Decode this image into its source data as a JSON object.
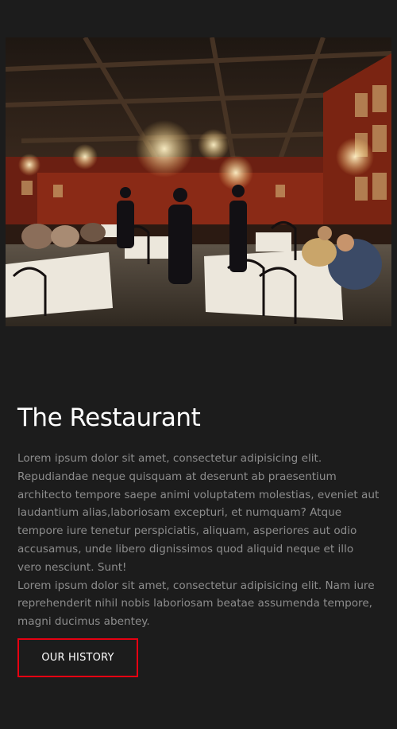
{
  "section": {
    "image_alt": "Restaurant dining room",
    "title": "The Restaurant",
    "paragraph_1": "Lorem ipsum dolor sit amet, consectetur adipisicing elit. Repudiandae neque quisquam at deserunt ab praesentium architecto tempore saepe animi voluptatem molestias, eveniet aut laudantium alias,laboriosam excepturi, et numquam? Atque tempore iure tenetur perspiciatis, aliquam, asperiores aut odio accusamus, unde libero dignissimos quod aliquid neque et illo vero nesciunt. Sunt!",
    "paragraph_2": "Lorem ipsum dolor sit amet, consectetur adipisicing elit. Nam iure reprehenderit nihil nobis laboriosam beatae assumenda tempore, magni ducimus abentey.",
    "button_label": "OUR HISTORY"
  },
  "colors": {
    "background": "#1c1c1c",
    "title": "#ffffff",
    "body_text": "#8d8d8d",
    "button_border": "#e60012"
  }
}
